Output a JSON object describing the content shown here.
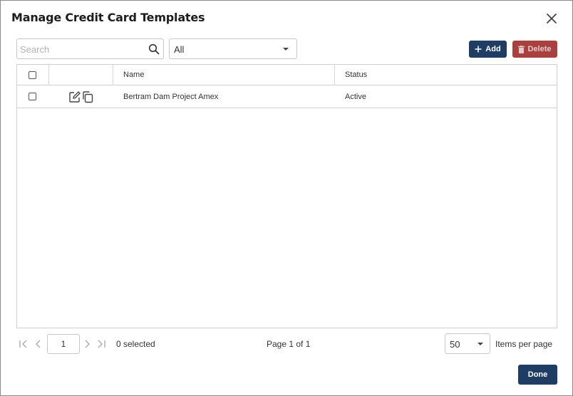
{
  "dialog": {
    "title": "Manage Credit Card Templates"
  },
  "toolbar": {
    "search_placeholder": "Search",
    "filter_value": "All",
    "add_label": "Add",
    "delete_label": "Delete"
  },
  "grid": {
    "columns": [
      "",
      "",
      "Name",
      "Status"
    ],
    "rows": [
      {
        "name": "Bertram Dam Project Amex",
        "status": "Active",
        "checked": false
      }
    ]
  },
  "pager": {
    "page_value": "1",
    "selected_text": "0 selected",
    "page_text": "Page 1 of 1",
    "per_page_value": "50",
    "per_page_label": "Items per page"
  },
  "footer": {
    "done_label": "Done"
  },
  "colors": {
    "primary": "#1f3d63",
    "danger": "#a94040",
    "border": "#cfcfcf"
  },
  "icons": {
    "close": "close-icon",
    "search": "search-icon",
    "caret": "chevron-down-icon",
    "add": "plus-icon",
    "delete": "trash-icon",
    "edit": "edit-icon",
    "copy": "copy-icon",
    "first": "first-page-icon",
    "prev": "prev-page-icon",
    "next": "next-page-icon",
    "last": "last-page-icon"
  }
}
